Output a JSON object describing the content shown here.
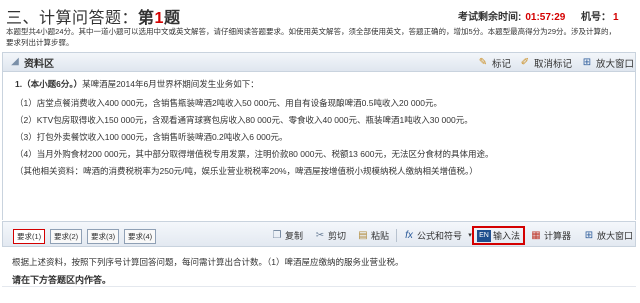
{
  "header": {
    "section": "三、计算问答题：",
    "question_prefix": "第",
    "question_number": "1",
    "question_suffix": "题",
    "timer_label": "考试剩余时间:",
    "timer_value": "01:57:29",
    "machine_label": "机号：",
    "machine_value": "1"
  },
  "instructions": [
    "本题型共4小题24分。其中一道小题可以选用中文或英文解答，请仔细阅读答题要求。如使用英文解答，须全部使用英文，答题正确的，增加5分。本题型最高得分为29分。涉及计算的，",
    "要求列出计算步骤。"
  ],
  "material_panel": {
    "title": "资料区",
    "mark": "标记",
    "unmark": "取消标记",
    "enlarge": "放大窗口"
  },
  "material_lines": {
    "intro_bold": "1.（本小题6分。）",
    "intro": "某啤酒屋2014年6月世界杯期间发生业务如下：",
    "item1": "（1）店堂点餐消费收入400 000元，含销售瓶装啤酒2吨收入50 000元、用自有设备现酿啤酒0.5吨收入20 000元。",
    "item2": "（2）KTV包房取得收入150 000元，含观看通宵球赛包房收入80 000元、零食收入40 000元、瓶装啤酒1吨收入30 000元。",
    "item3": "（3）打包外卖餐饮收入100 000元，含销售听装啤酒0.2吨收入6 000元。",
    "item4": "（4）当月外购食材200 000元，其中部分取得增值税专用发票，注明价款80 000元、税额13 600元，无法区分食材的具体用途。",
    "item5": "（其他相关资料：啤酒的消费税税率为250元/吨，娱乐业营业税税率20%，啤酒屋按增值税小规模纳税人缴纳相关增值税。）"
  },
  "toolbar": {
    "tabs": [
      "要求(1)",
      "要求(2)",
      "要求(3)",
      "要求(4)"
    ],
    "copy": "复制",
    "cut": "剪切",
    "paste": "粘贴",
    "formula": "公式和符号",
    "ime": "输入法",
    "calculator": "计算器",
    "enlarge": "放大窗口"
  },
  "answer": {
    "prompt": "根据上述资料，按照下列序号计算回答问题，每问需计算出合计数。（1）啤酒屋应缴纳的服务业营业税。",
    "label": "请在下方答题区内作答。"
  },
  "colors": {
    "accent_red": "#d40000",
    "panel_bg": "#e3e9f1",
    "border": "#c9d3de"
  }
}
